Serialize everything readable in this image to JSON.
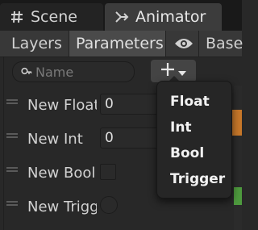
{
  "tabs": [
    {
      "label": "Scene",
      "icon": "hash-icon"
    },
    {
      "label": "Animator",
      "icon": "animator-icon"
    }
  ],
  "subtabs": {
    "layers": "Layers",
    "parameters": "Parameters",
    "visibility_icon": "eye-icon",
    "base": "Base"
  },
  "search": {
    "placeholder": "Name",
    "value": ""
  },
  "add_button": {
    "label": "+",
    "icon": "chevron-down-icon"
  },
  "parameters": [
    {
      "name": "New Float",
      "type": "float",
      "value": "0"
    },
    {
      "name": "New Int",
      "type": "int",
      "value": "0"
    },
    {
      "name": "New Bool",
      "type": "bool",
      "value": false
    },
    {
      "name": "New Trigger",
      "type": "trigger"
    }
  ],
  "dropdown": {
    "items": [
      "Float",
      "Int",
      "Bool",
      "Trigger"
    ]
  },
  "colors": {
    "background": "#282828",
    "tab_active": "#3c3c3c",
    "menu": "#262626",
    "accent_orange": "#c8782a",
    "accent_green": "#4e9a3e"
  }
}
